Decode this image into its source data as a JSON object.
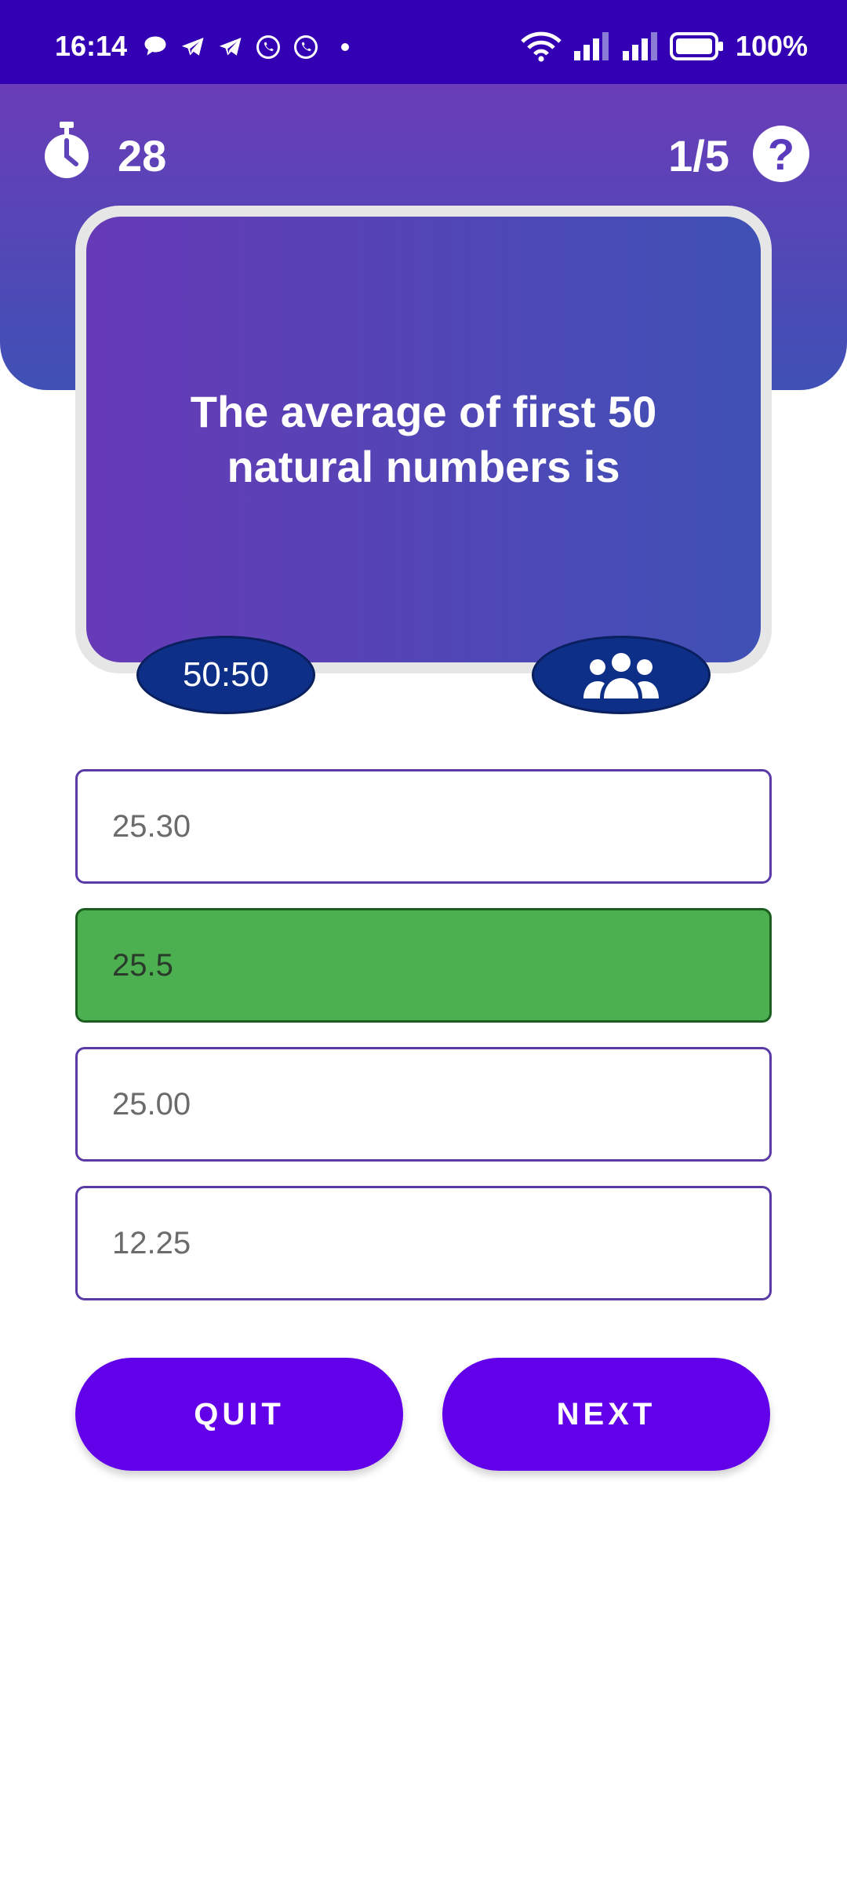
{
  "status_bar": {
    "time": "16:14",
    "battery": "100%",
    "notification_icons": [
      "chat-bubble-icon",
      "telegram-icon",
      "telegram-icon",
      "whatsapp-icon",
      "whatsapp-icon",
      "dot-icon"
    ]
  },
  "header": {
    "timer_value": "28",
    "progress": "1/5",
    "help_symbol": "?"
  },
  "question": {
    "text": "The average of first 50 natural numbers is"
  },
  "lifelines": {
    "fifty_fifty_label": "50:50",
    "audience_icon": "group-icon"
  },
  "options": [
    {
      "label": "25.30",
      "state": "default"
    },
    {
      "label": "25.5",
      "state": "correct"
    },
    {
      "label": "25.00",
      "state": "default"
    },
    {
      "label": "12.25",
      "state": "default"
    }
  ],
  "buttons": {
    "quit": "QUIT",
    "next": "NEXT"
  },
  "colors": {
    "status_bar": "#3300b3",
    "header_gradient_start": "#6a3cb8",
    "header_gradient_end": "#3f51b5",
    "lifeline_bg": "#0d2f87",
    "correct_option": "#4caf50",
    "button": "#6200ea"
  }
}
